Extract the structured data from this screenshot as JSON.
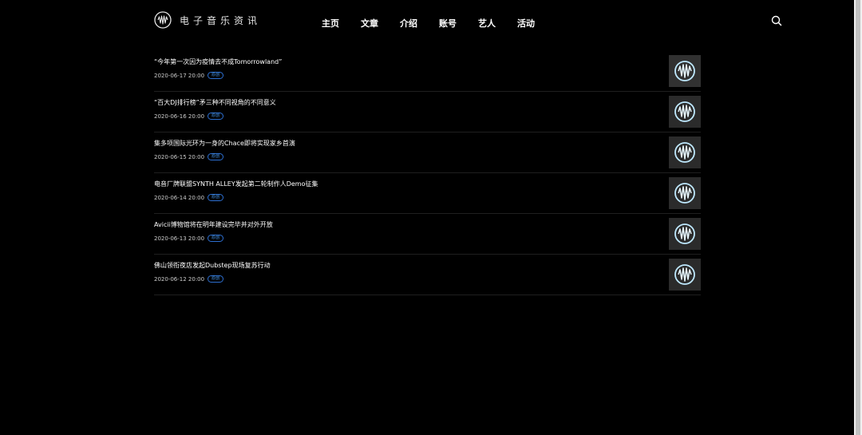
{
  "header": {
    "logo_text": "电子音乐资讯",
    "nav": [
      "主页",
      "文章",
      "介绍",
      "账号",
      "艺人",
      "活动"
    ]
  },
  "articles": [
    {
      "title": "“今年第一次因为疫情去不成Tomorrowland”",
      "date": "2020-06-17 20:00",
      "badge": "原创"
    },
    {
      "title": "“百大DJ排行榜”矛三种不同视角的不同意义",
      "date": "2020-06-16 20:00",
      "badge": "原创"
    },
    {
      "title": "集多项国际光环为一身的Chace即将实现家乡首演",
      "date": "2020-06-15 20:00",
      "badge": "原创"
    },
    {
      "title": "电音厂牌联盟SYNTH ALLEY发起第二轮制作人Demo征集",
      "date": "2020-06-14 20:00",
      "badge": "原创"
    },
    {
      "title": "Avicii博物馆将在明年建设完毕并对外开放",
      "date": "2020-06-13 20:00",
      "badge": "原创"
    },
    {
      "title": "佛山领衔夜店发起Dubstep现场复苏行动",
      "date": "2020-06-12 20:00",
      "badge": "原创"
    }
  ],
  "colors": {
    "background": "#000000",
    "badge": "#4da3ff",
    "thumb_glow": "#bfe9ff"
  },
  "icons": {
    "logo": "waveform-circle-logo-icon",
    "search": "search-icon",
    "thumb": "neon-waveform-logo-thumbnail"
  }
}
